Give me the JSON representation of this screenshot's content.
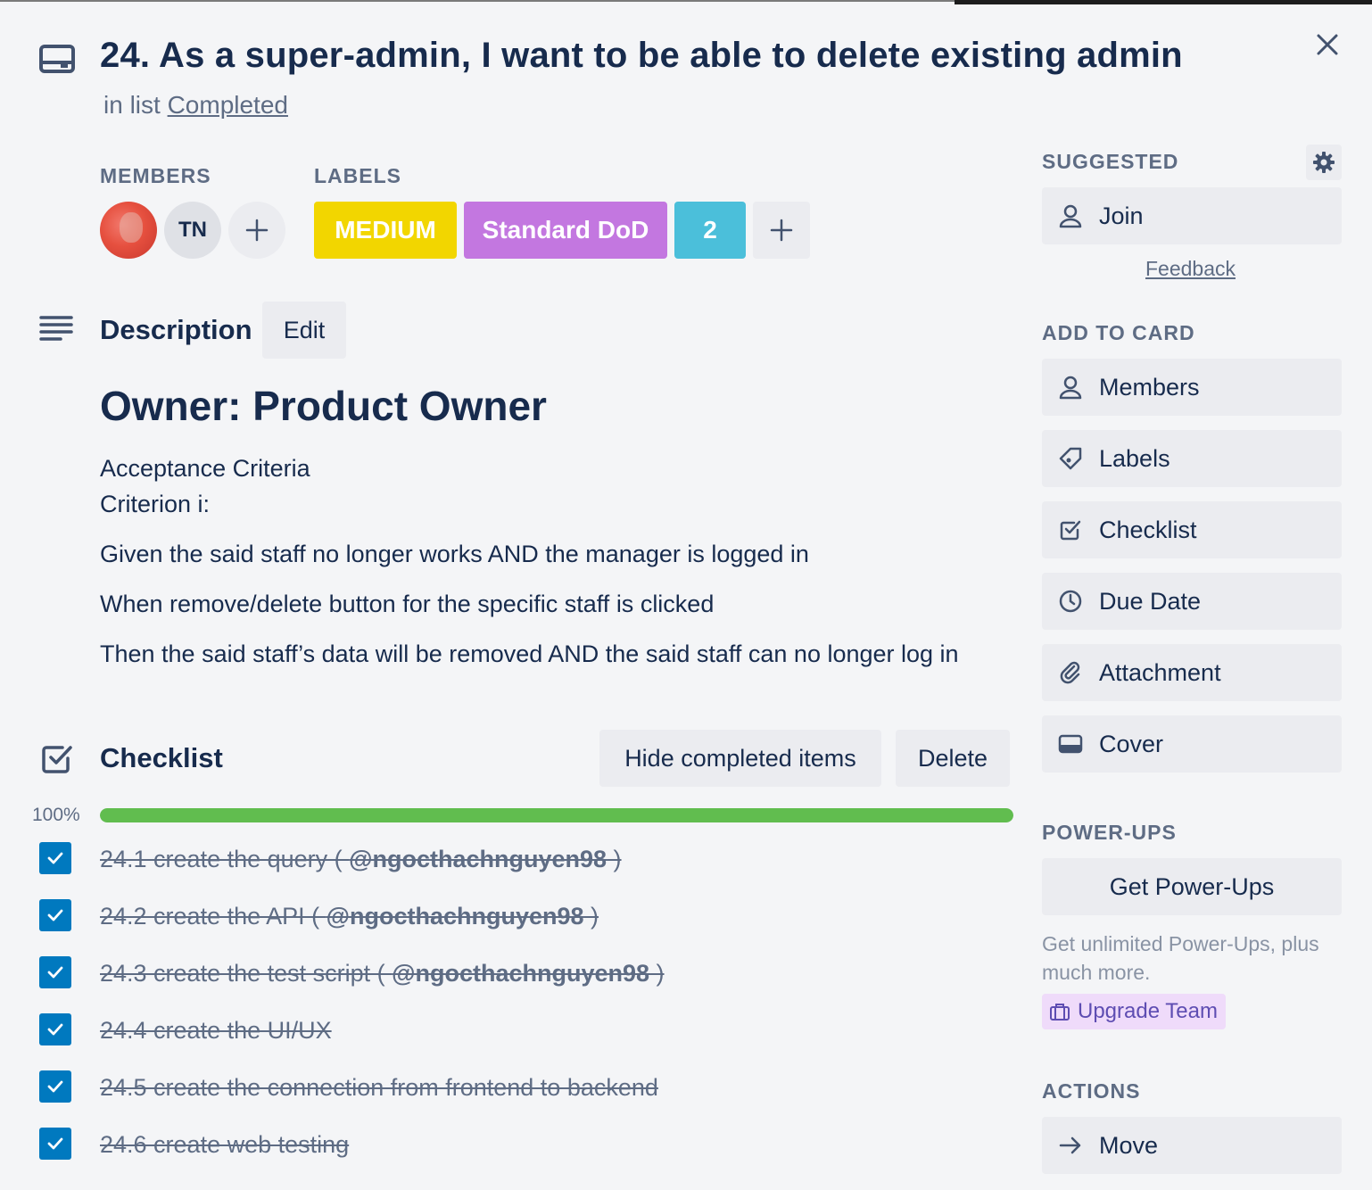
{
  "card": {
    "title": "24. As a super-admin, I want to be able to delete existing admin",
    "in_list_prefix": "in list",
    "list_name": "Completed"
  },
  "members": {
    "heading": "MEMBERS",
    "initials": "TN"
  },
  "labels": {
    "heading": "LABELS",
    "items": [
      {
        "text": "MEDIUM",
        "color": "#f2d600"
      },
      {
        "text": "Standard DoD",
        "color": "#c377e0"
      },
      {
        "text": "2",
        "color": "#4bbfda"
      }
    ]
  },
  "description": {
    "heading": "Description",
    "edit_label": "Edit",
    "owner_heading": "Owner: Product Owner",
    "lines": [
      "Acceptance Criteria",
      "Criterion i:",
      "Given the said staff no longer works AND the manager is logged in",
      "When remove/delete button for the specific staff is clicked",
      "Then the said staff’s data will be removed AND the said staff can no longer log in"
    ]
  },
  "checklist": {
    "heading": "Checklist",
    "hide_label": "Hide completed items",
    "delete_label": "Delete",
    "progress_label": "100%",
    "progress": 1.0,
    "items": [
      {
        "text": "24.1 create the query ( ",
        "mention": "@ngocthachnguyen98",
        "suffix": " )",
        "checked": true
      },
      {
        "text": "24.2 create the API ( ",
        "mention": "@ngocthachnguyen98",
        "suffix": " )",
        "checked": true
      },
      {
        "text": "24.3 create the test script ( ",
        "mention": "@ngocthachnguyen98",
        "suffix": " )",
        "checked": true
      },
      {
        "text": "24.4 create the UI/UX",
        "mention": "",
        "suffix": "",
        "checked": true
      },
      {
        "text": "24.5 create the connection from frontend to backend",
        "mention": "",
        "suffix": "",
        "checked": true
      },
      {
        "text": "24.6 create web testing",
        "mention": "",
        "suffix": "",
        "checked": true
      }
    ]
  },
  "sidebar": {
    "suggested_heading": "SUGGESTED",
    "join_label": "Join",
    "feedback_label": "Feedback",
    "add_heading": "ADD TO CARD",
    "add_items": [
      {
        "label": "Members",
        "icon": "person-icon"
      },
      {
        "label": "Labels",
        "icon": "tag-icon"
      },
      {
        "label": "Checklist",
        "icon": "checklist-icon"
      },
      {
        "label": "Due Date",
        "icon": "clock-icon"
      },
      {
        "label": "Attachment",
        "icon": "paperclip-icon"
      },
      {
        "label": "Cover",
        "icon": "cover-icon"
      }
    ],
    "powerups_heading": "POWER-UPS",
    "get_powerups_label": "Get Power-Ups",
    "powerups_text": "Get unlimited Power-Ups, plus much more.",
    "upgrade_label": "Upgrade Team",
    "actions_heading": "ACTIONS",
    "move_label": "Move"
  },
  "colors": {
    "background": "#f4f5f7",
    "button": "#ebecf0",
    "checkbox": "#0079bf",
    "progress": "#61bd4f",
    "upgrade_bg": "#efdbfa"
  }
}
